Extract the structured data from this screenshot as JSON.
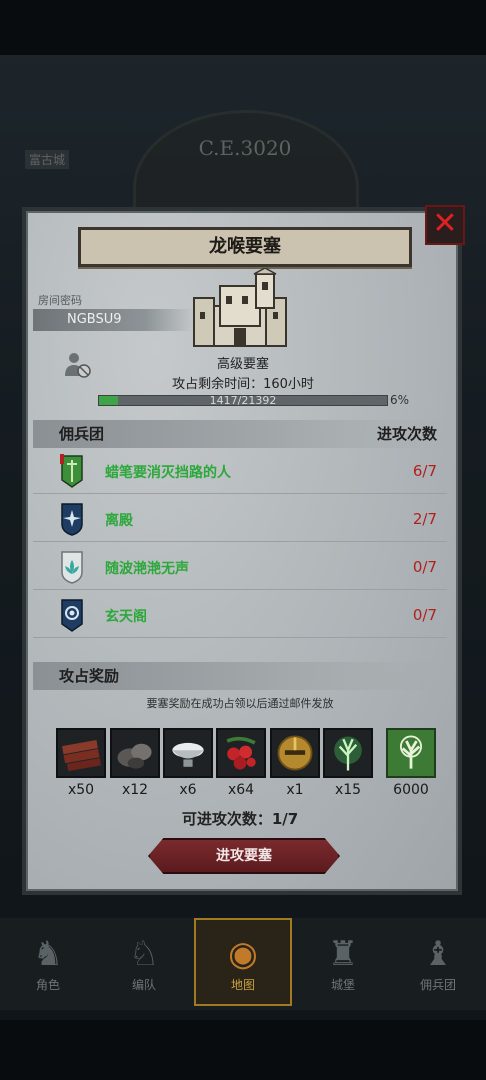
{
  "background": {
    "year": "C.E.3020",
    "tag": "富古城"
  },
  "panel": {
    "title": "龙喉要塞",
    "room_label": "房间密码",
    "room_code": "NGBSU9",
    "fort_type": "高级要塞",
    "time_left": "攻占剩余时间：160小时",
    "progress": {
      "text": "1417/21392",
      "percent_label": "6%",
      "fraction": 0.066
    },
    "close_icon": "close-x-icon"
  },
  "mercenaries": {
    "header_left": "佣兵团",
    "header_right": "进攻次数",
    "rows": [
      {
        "name": "蜡笔要消灭挡路的人",
        "count": "6/7",
        "emblem": "green-banner-icon",
        "color": "#3d8f3a"
      },
      {
        "name": "离殿",
        "count": "2/7",
        "emblem": "star-shield-icon",
        "color": "#1f3d63"
      },
      {
        "name": "随波滟滟无声",
        "count": "0/7",
        "emblem": "lotus-shield-icon",
        "color": "#dfe5e4"
      },
      {
        "name": "玄天阁",
        "count": "0/7",
        "emblem": "eye-banner-icon",
        "color": "#1f3d63"
      }
    ]
  },
  "rewards": {
    "header": "攻占奖励",
    "notice": "要塞奖励在成功占领以后通过邮件发放",
    "items": [
      {
        "icon": "wood-planks-icon",
        "qty": "x50"
      },
      {
        "icon": "ore-rocks-icon",
        "qty": "x12"
      },
      {
        "icon": "salt-bowl-icon",
        "qty": "x6"
      },
      {
        "icon": "berries-icon",
        "qty": "x64"
      },
      {
        "icon": "golden-helmet-icon",
        "qty": "x1"
      },
      {
        "icon": "magic-tree-icon",
        "qty": "x15"
      },
      {
        "icon": "tree-banner-icon",
        "qty": "6000"
      }
    ]
  },
  "attempts": "可进攻次数：1/7",
  "attack_button": "进攻要塞",
  "nav": [
    {
      "label": "角色",
      "icon": "warrior-icon"
    },
    {
      "label": "编队",
      "icon": "knight-icon"
    },
    {
      "label": "地图",
      "icon": "map-globe-icon",
      "active": true
    },
    {
      "label": "城堡",
      "icon": "castle-icon"
    },
    {
      "label": "佣兵团",
      "icon": "armored-knight-icon"
    }
  ]
}
